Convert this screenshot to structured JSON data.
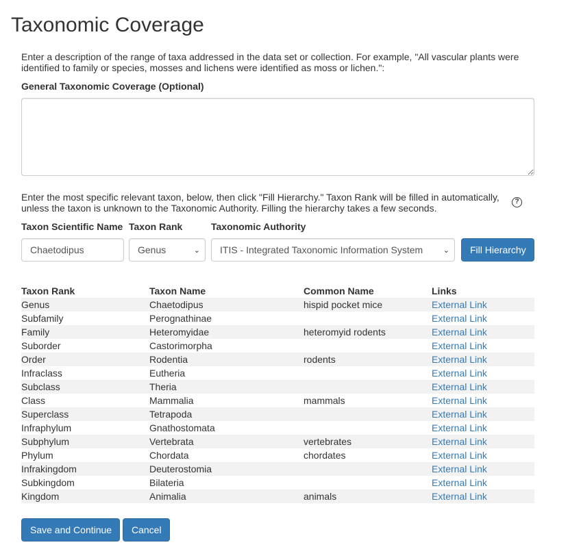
{
  "page": {
    "title": "Taxonomic Coverage",
    "description": "Enter a description of the range of taxa addressed in the data set or collection. For example, \"All vascular plants were identified to family or species, mosses and lichens were identified as moss or lichen.\":",
    "general_label": "General Taxonomic Coverage (Optional)",
    "general_value": "",
    "instructions": "Enter the most specific relevant taxon, below, then click \"Fill Hierarchy.\" Taxon Rank will be filled in automatically, unless the taxon is unknown to the Taxonomic Authority. Filling the hierarchy takes a few seconds.",
    "help_icon": "question-circle-icon",
    "help_glyph": "?"
  },
  "form": {
    "scientific_name_label": "Taxon Scientific Name",
    "scientific_name_value": "Chaetodipus",
    "rank_label": "Taxon Rank",
    "rank_value": "Genus",
    "authority_label": "Taxonomic Authority",
    "authority_value": "ITIS - Integrated Taxonomic Information System",
    "fill_button": "Fill Hierarchy"
  },
  "table": {
    "headers": [
      "Taxon Rank",
      "Taxon Name",
      "Common Name",
      "Links"
    ],
    "rows": [
      {
        "rank": "Genus",
        "name": "Chaetodipus",
        "common": "hispid pocket mice",
        "link": "External Link"
      },
      {
        "rank": "Subfamily",
        "name": "Perognathinae",
        "common": "",
        "link": "External Link"
      },
      {
        "rank": "Family",
        "name": "Heteromyidae",
        "common": "heteromyid rodents",
        "link": "External Link"
      },
      {
        "rank": "Suborder",
        "name": "Castorimorpha",
        "common": "",
        "link": "External Link"
      },
      {
        "rank": "Order",
        "name": "Rodentia",
        "common": "rodents",
        "link": "External Link"
      },
      {
        "rank": "Infraclass",
        "name": "Eutheria",
        "common": "",
        "link": "External Link"
      },
      {
        "rank": "Subclass",
        "name": "Theria",
        "common": "",
        "link": "External Link"
      },
      {
        "rank": "Class",
        "name": "Mammalia",
        "common": "mammals",
        "link": "External Link"
      },
      {
        "rank": "Superclass",
        "name": "Tetrapoda",
        "common": "",
        "link": "External Link"
      },
      {
        "rank": "Infraphylum",
        "name": "Gnathostomata",
        "common": "",
        "link": "External Link"
      },
      {
        "rank": "Subphylum",
        "name": "Vertebrata",
        "common": "vertebrates",
        "link": "External Link"
      },
      {
        "rank": "Phylum",
        "name": "Chordata",
        "common": "chordates",
        "link": "External Link"
      },
      {
        "rank": "Infrakingdom",
        "name": "Deuterostomia",
        "common": "",
        "link": "External Link"
      },
      {
        "rank": "Subkingdom",
        "name": "Bilateria",
        "common": "",
        "link": "External Link"
      },
      {
        "rank": "Kingdom",
        "name": "Animalia",
        "common": "animals",
        "link": "External Link"
      }
    ]
  },
  "actions": {
    "save": "Save and Continue",
    "cancel": "Cancel"
  },
  "colors": {
    "primary": "#337ab7",
    "stripe": "#f2f2f2",
    "text": "#333333"
  }
}
